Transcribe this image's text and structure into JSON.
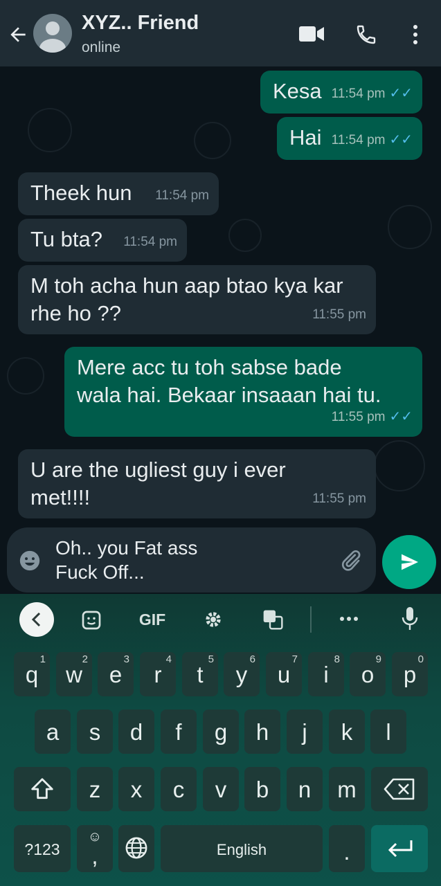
{
  "header": {
    "contact_name": "XYZ.. Friend",
    "status": "online",
    "icons": [
      "back-arrow-icon",
      "avatar-icon",
      "video-call-icon",
      "phone-icon",
      "more-vert-icon"
    ]
  },
  "messages": [
    {
      "direction": "out",
      "text": "Kesa",
      "time": "11:54 pm",
      "read": true
    },
    {
      "direction": "out",
      "text": "Hai",
      "time": "11:54 pm",
      "read": true
    },
    {
      "direction": "in",
      "text": "Theek hun",
      "time": "11:54 pm"
    },
    {
      "direction": "in",
      "text": "Tu bta?",
      "time": "11:54 pm"
    },
    {
      "direction": "in",
      "text": "M toh acha hun aap btao kya kar\nrhe ho ??",
      "time": "11:55 pm"
    },
    {
      "direction": "out",
      "text": "Mere acc tu toh sabse bade\nwala hai. Bekaar insaaan hai tu.",
      "time": "11:55 pm",
      "read": true
    },
    {
      "direction": "in",
      "text": "U are the ugliest guy i ever\nmet!!!!",
      "time": "11:55 pm"
    }
  ],
  "composer": {
    "text_line1": "Oh.. you Fat ass",
    "text_line2": "Fuck Off..."
  },
  "keyboard": {
    "toolbar": {
      "gif_label": "GIF"
    },
    "row1": [
      {
        "key": "q",
        "hint": "1"
      },
      {
        "key": "w",
        "hint": "2"
      },
      {
        "key": "e",
        "hint": "3"
      },
      {
        "key": "r",
        "hint": "4"
      },
      {
        "key": "t",
        "hint": "5"
      },
      {
        "key": "y",
        "hint": "6"
      },
      {
        "key": "u",
        "hint": "7"
      },
      {
        "key": "i",
        "hint": "8"
      },
      {
        "key": "o",
        "hint": "9"
      },
      {
        "key": "p",
        "hint": "0"
      }
    ],
    "row2": [
      "a",
      "s",
      "d",
      "f",
      "g",
      "h",
      "j",
      "k",
      "l"
    ],
    "row3": [
      "z",
      "x",
      "c",
      "v",
      "b",
      "n",
      "m"
    ],
    "symbols_label": "?123",
    "comma_label": ",",
    "space_label": "English",
    "period_label": "."
  },
  "colors": {
    "outgoing_bubble": "#005c4b",
    "incoming_bubble": "#1f2c34",
    "header": "#1f2c34",
    "read_ticks": "#53bdeb",
    "send_button": "#00a884",
    "enter_key": "#0b6b62"
  }
}
